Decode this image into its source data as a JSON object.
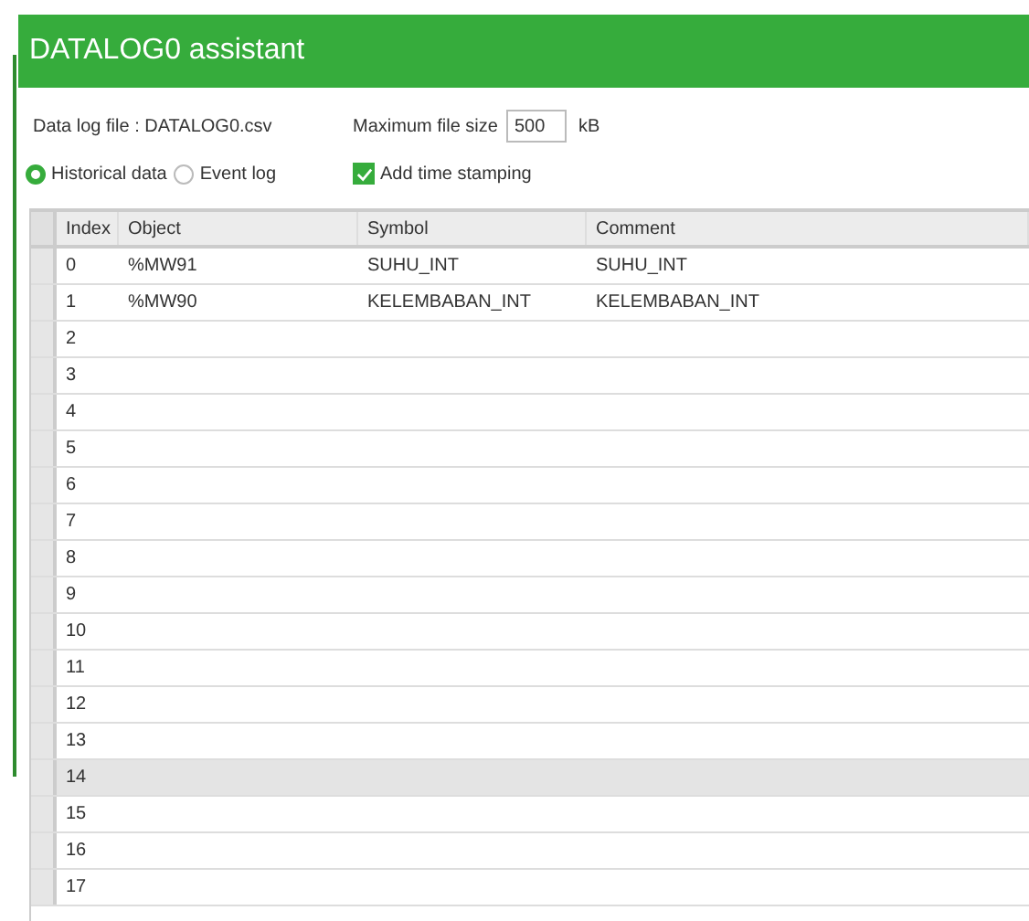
{
  "window": {
    "title": "DATALOG0 assistant"
  },
  "data_log_file": {
    "label": "Data log file : DATALOG0.csv"
  },
  "max_file_size": {
    "label": "Maximum file size",
    "value": "500",
    "unit": "kB"
  },
  "log_type": [
    {
      "label": "Historical data",
      "selected": true
    },
    {
      "label": "Event log",
      "selected": false
    }
  ],
  "time_stamping": {
    "label": "Add time stamping",
    "checked": true
  },
  "table": {
    "columns": [
      "Index",
      "Object",
      "Symbol",
      "Comment"
    ],
    "rows": [
      {
        "cells": [
          "0",
          "%MW91",
          "SUHU_INT",
          "SUHU_INT"
        ],
        "selected": false
      },
      {
        "cells": [
          "1",
          "%MW90",
          "KELEMBABAN_INT",
          "KELEMBABAN_INT"
        ],
        "selected": false
      },
      {
        "cells": [
          "2"
        ],
        "selected": false
      },
      {
        "cells": [
          "3"
        ],
        "selected": false
      },
      {
        "cells": [
          "4"
        ],
        "selected": false
      },
      {
        "cells": [
          "5"
        ],
        "selected": false
      },
      {
        "cells": [
          "6"
        ],
        "selected": false
      },
      {
        "cells": [
          "7"
        ],
        "selected": false
      },
      {
        "cells": [
          "8"
        ],
        "selected": false
      },
      {
        "cells": [
          "9"
        ],
        "selected": false
      },
      {
        "cells": [
          "10"
        ],
        "selected": false
      },
      {
        "cells": [
          "11"
        ],
        "selected": false
      },
      {
        "cells": [
          "12"
        ],
        "selected": false
      },
      {
        "cells": [
          "13"
        ],
        "selected": false
      },
      {
        "cells": [
          "14"
        ],
        "selected": true
      },
      {
        "cells": [
          "15"
        ],
        "selected": false
      },
      {
        "cells": [
          "16"
        ],
        "selected": false
      },
      {
        "cells": [
          "17"
        ],
        "selected": false
      }
    ]
  }
}
